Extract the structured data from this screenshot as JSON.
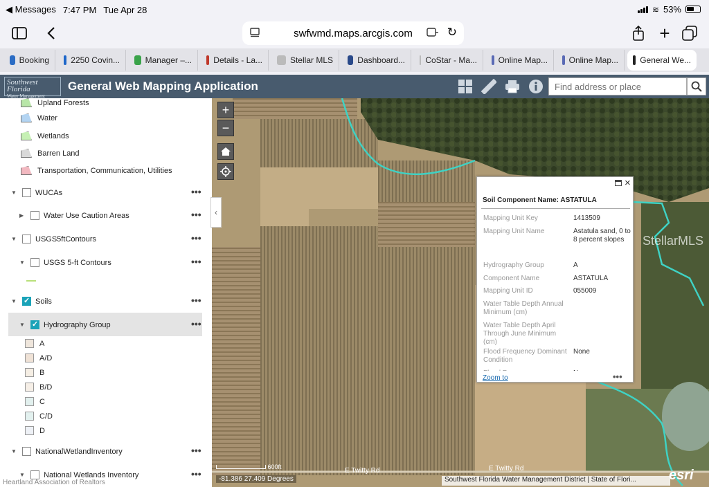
{
  "status": {
    "back_app": "Messages",
    "time": "7:47 PM",
    "date": "Tue Apr 28",
    "battery": "53%"
  },
  "browser": {
    "url": "swfwmd.maps.arcgis.com",
    "tabs": [
      {
        "label": "Booking",
        "color": "#2b6cc4"
      },
      {
        "label": "2250 Covin...",
        "color": "#1e67c9"
      },
      {
        "label": "Manager –...",
        "color": "#3aa34a"
      },
      {
        "label": "Details - La...",
        "color": "#c0392b"
      },
      {
        "label": "Stellar MLS",
        "color": "#bbbbbb"
      },
      {
        "label": "Dashboard...",
        "color": "#2a4a8a"
      },
      {
        "label": "CoStar - Ma...",
        "color": "#bbbbbb"
      },
      {
        "label": "Online Map...",
        "color": "#5b6bb5"
      },
      {
        "label": "Online Map...",
        "color": "#5b6bb5"
      },
      {
        "label": "General We...",
        "color": "#222222"
      }
    ]
  },
  "app": {
    "logo_line1": "Southwest Florida",
    "logo_line2": "Water Management District",
    "title": "General Web Mapping Application",
    "search_placeholder": "Find address or place"
  },
  "legend": [
    {
      "label": "Upland Forests",
      "color": "#b8e6a8"
    },
    {
      "label": "Water",
      "color": "#b3d4f2"
    },
    {
      "label": "Wetlands",
      "color": "#c6f0b4"
    },
    {
      "label": "Barren Land",
      "color": "#d9d9d9"
    },
    {
      "label": "Transportation, Communication, Utilities",
      "color": "#f2b8c0"
    }
  ],
  "layers": {
    "wucas": "WUCAs",
    "wuca_sub": "Water Use Caution Areas",
    "usgs": "USGS5ftContours",
    "usgs_sub": "USGS 5-ft Contours",
    "soils": "Soils",
    "hydro": "Hydrography Group",
    "nwi": "NationalWetlandInventory",
    "nwi_sub": "National Wetlands Inventory"
  },
  "hydro_classes": [
    {
      "label": "A",
      "color": "#efe6dc"
    },
    {
      "label": "A/D",
      "color": "#efe2d6"
    },
    {
      "label": "B",
      "color": "#f5eee4"
    },
    {
      "label": "B/D",
      "color": "#f6efe7"
    },
    {
      "label": "C",
      "color": "#e2f0ee"
    },
    {
      "label": "C/D",
      "color": "#e3f1ef"
    },
    {
      "label": "D",
      "color": "#eef1f6"
    }
  ],
  "popup": {
    "title": "Soil Component Name: ASTATULA",
    "fields": [
      {
        "key": "Mapping Unit Key",
        "value": "1413509"
      },
      {
        "key": "Mapping Unit Name",
        "value": "Astatula sand, 0 to 8 percent slopes"
      },
      {
        "key": "Hydrography Group",
        "value": "A"
      },
      {
        "key": "Component Name",
        "value": "ASTATULA"
      },
      {
        "key": "Mapping Unit ID",
        "value": "055009"
      },
      {
        "key": "Water Table Depth Annual Minimum (cm)",
        "value": ""
      },
      {
        "key": "Water Table Depth April Through June Minimum (cm)",
        "value": ""
      },
      {
        "key": "Flood Frequency Dominant Condition",
        "value": "None"
      },
      {
        "key": "Flood Frequency",
        "value": "None"
      }
    ],
    "zoom_to": "Zoom to"
  },
  "map": {
    "scale": "600ft",
    "coords": "-81.386 27.409 Degrees",
    "road1": "E Twitty Rd",
    "road2": "E Twitty Rd",
    "attribution": "Southwest Florida Water Management District | State of Flori...",
    "esri": "esri",
    "stellar": "StellarMLS"
  },
  "footer": "Heartland Association of Realtors"
}
